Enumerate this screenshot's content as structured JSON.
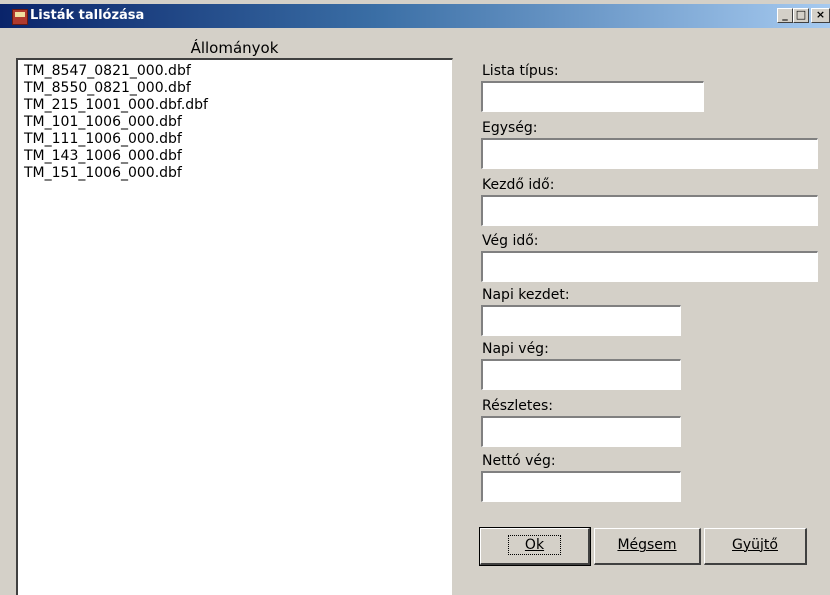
{
  "window": {
    "title": "Listák tallózása",
    "controls": {
      "minimize": "_",
      "maximize": "□",
      "close": "×"
    }
  },
  "files": {
    "header": "Állományok",
    "items": [
      "TM_8547_0821_000.dbf",
      "TM_8550_0821_000.dbf",
      "TM_215_1001_000.dbf.dbf",
      "TM_101_1006_000.dbf",
      "TM_111_1006_000.dbf",
      "TM_143_1006_000.dbf",
      "TM_151_1006_000.dbf"
    ]
  },
  "form": {
    "lista_tipus": {
      "label": "Lista típus:",
      "value": ""
    },
    "egyseg": {
      "label": "Egység:",
      "value": ""
    },
    "kezdo_ido": {
      "label": "Kezdő idő:",
      "value": ""
    },
    "veg_ido": {
      "label": "Vég idő:",
      "value": ""
    },
    "napi_kezdet": {
      "label": "Napi kezdet:",
      "value": ""
    },
    "napi_veg": {
      "label": "Napi vég:",
      "value": ""
    },
    "reszletes": {
      "label": "Részletes:",
      "value": ""
    },
    "netto_veg": {
      "label": "Nettó vég:",
      "value": ""
    }
  },
  "buttons": {
    "ok": "Ok",
    "cancel": "Mégsem",
    "collect": "Gyüjtő"
  }
}
